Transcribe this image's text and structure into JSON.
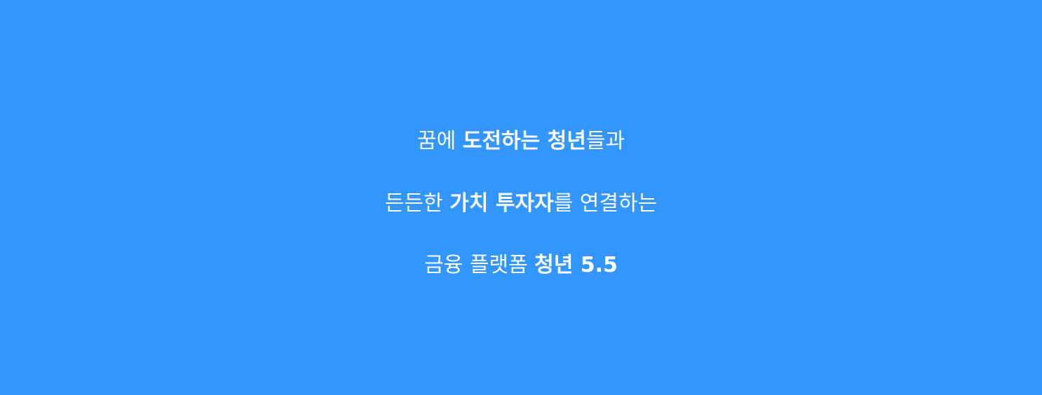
{
  "banner": {
    "background_color": "#3396ff",
    "text_color": "#ffffff",
    "lines": [
      {
        "segments": [
          {
            "text": "꿈에 ",
            "weight": "normal"
          },
          {
            "text": "도전하는 청년",
            "weight": "bold"
          },
          {
            "text": "들과",
            "weight": "normal"
          }
        ]
      },
      {
        "segments": [
          {
            "text": "든든한 ",
            "weight": "normal"
          },
          {
            "text": "가치 투자자",
            "weight": "bold"
          },
          {
            "text": "를 연결하는",
            "weight": "normal"
          }
        ]
      },
      {
        "segments": [
          {
            "text": "금융 플랫폼 ",
            "weight": "normal"
          },
          {
            "text": "청년 5.5",
            "weight": "bold"
          }
        ]
      }
    ]
  }
}
